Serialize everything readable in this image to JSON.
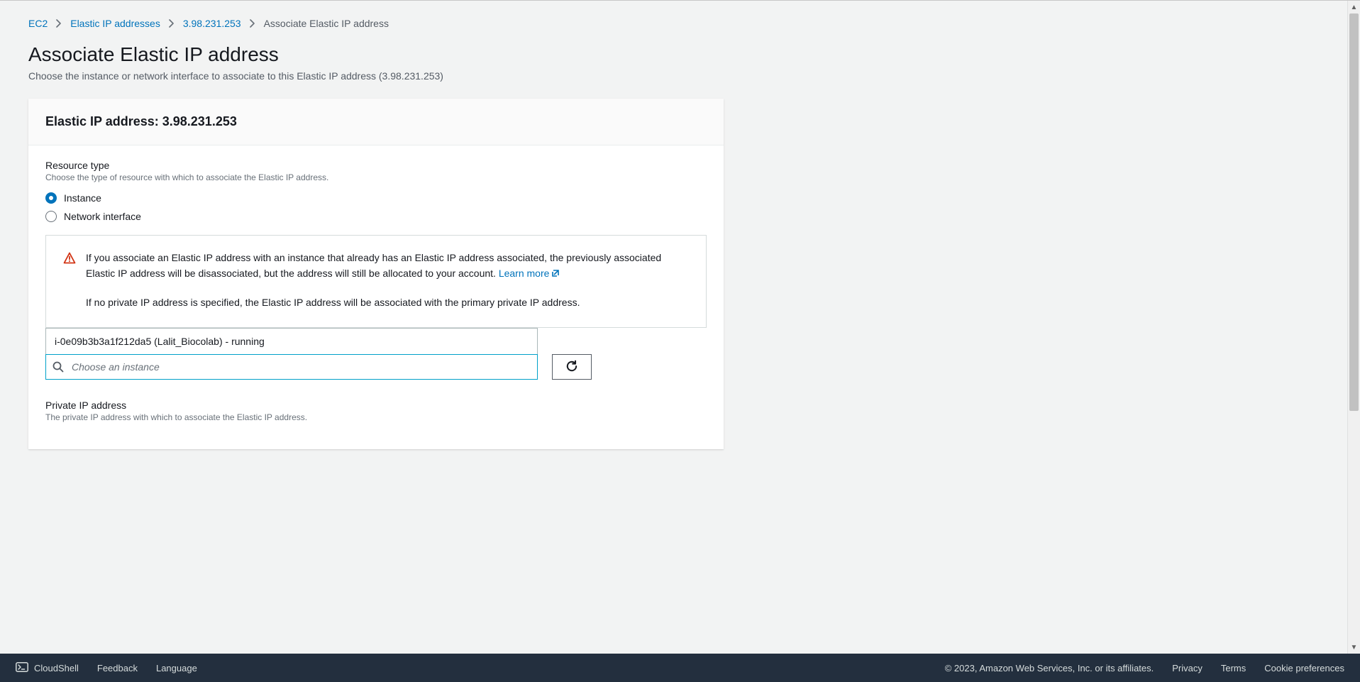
{
  "breadcrumb": {
    "items": [
      "EC2",
      "Elastic IP addresses",
      "3.98.231.253"
    ],
    "current": "Associate Elastic IP address"
  },
  "page": {
    "title": "Associate Elastic IP address",
    "subtitle": "Choose the instance or network interface to associate to this Elastic IP address (3.98.231.253)"
  },
  "panel": {
    "header": "Elastic IP address: 3.98.231.253",
    "resource_type": {
      "label": "Resource type",
      "desc": "Choose the type of resource with which to associate the Elastic IP address.",
      "options": {
        "instance": "Instance",
        "network_interface": "Network interface"
      },
      "selected": "instance"
    },
    "info": {
      "p1a": "If you associate an Elastic IP address with an instance that already has an Elastic IP address associated, the previously associated Elastic IP address will be disassociated, but the address will still be allocated to your account. ",
      "learn_more": "Learn more",
      "p2": "If no private IP address is specified, the Elastic IP address will be associated with the primary private IP address."
    },
    "instance": {
      "selected_display": "i-0e09b3b3a1f212da5 (Lalit_Biocolab) - running",
      "placeholder": "Choose an instance"
    },
    "private_ip": {
      "label": "Private IP address",
      "desc": "The private IP address with which to associate the Elastic IP address."
    }
  },
  "footer": {
    "cloudshell": "CloudShell",
    "feedback": "Feedback",
    "language": "Language",
    "copyright": "© 2023, Amazon Web Services, Inc. or its affiliates.",
    "privacy": "Privacy",
    "terms": "Terms",
    "cookies": "Cookie preferences"
  },
  "colors": {
    "link": "#0073bb",
    "warn": "#d13212",
    "footer_bg": "#232f3e"
  }
}
